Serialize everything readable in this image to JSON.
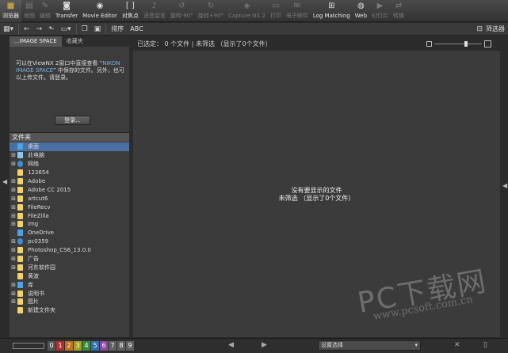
{
  "toolbar": {
    "buttons": [
      {
        "label": "浏览器",
        "icon": "browser-icon",
        "glyph": "▦",
        "active": true
      },
      {
        "label": "地图",
        "icon": "map-icon",
        "glyph": "▤",
        "dim": true
      },
      {
        "label": "编辑",
        "icon": "edit-icon",
        "glyph": "✎",
        "dim": true
      },
      {
        "label": "Transfer",
        "icon": "camera-icon",
        "glyph": "◙"
      },
      {
        "label": "Movie Editor",
        "icon": "movie-icon",
        "glyph": "◉"
      },
      {
        "label": "对焦点",
        "icon": "focus-icon",
        "glyph": "[ ]"
      },
      {
        "label": "语音留言",
        "icon": "voice-icon",
        "glyph": "♪",
        "dim": true
      },
      {
        "label": "旋转-90°",
        "icon": "rotate-left-icon",
        "glyph": "↺",
        "dim": true
      },
      {
        "label": "旋转+90°",
        "icon": "rotate-right-icon",
        "glyph": "↻",
        "dim": true
      },
      {
        "label": "Capture NX 2",
        "icon": "capture-icon",
        "glyph": "◈",
        "dim": true
      },
      {
        "label": "打印",
        "icon": "print-icon",
        "glyph": "▭",
        "dim": true
      },
      {
        "label": "电子邮件",
        "icon": "email-icon",
        "glyph": "✉",
        "dim": true
      },
      {
        "label": "Log Matching",
        "icon": "log-icon",
        "glyph": "⊞"
      },
      {
        "label": "Web",
        "icon": "web-icon",
        "glyph": "◍"
      },
      {
        "label": "幻灯片",
        "icon": "slideshow-icon",
        "glyph": "▶",
        "dim": true
      },
      {
        "label": "转换",
        "icon": "convert-icon",
        "glyph": "⇄",
        "dim": true
      }
    ]
  },
  "subbar": {
    "sort_label": "排序",
    "sort_value": "ABC",
    "filter_label": "筛选器"
  },
  "leftpane": {
    "tabs": [
      "...IMAGE SPACE",
      "收藏夹"
    ],
    "info_pre": "可以在ViewNX 2窗口中直接查看 “",
    "info_link": "NIKON IMAGE SPACE",
    "info_post": "” 中保存的文件。另外，也可以上传文件。请登录。",
    "login_button": "登录...",
    "folder_header": "文件夹",
    "tree": [
      {
        "label": "桌面",
        "exp": "",
        "icon": "f-blue",
        "sel": true
      },
      {
        "label": "此电脑",
        "exp": "+",
        "icon": "f-pc"
      },
      {
        "label": "网络",
        "exp": "+",
        "icon": "f-globe"
      },
      {
        "label": "123654",
        "exp": "",
        "icon": "f-yellow"
      },
      {
        "label": "Adobe",
        "exp": "+",
        "icon": "f-yellow"
      },
      {
        "label": "Adobe CC 2015",
        "exp": "+",
        "icon": "f-yellow"
      },
      {
        "label": "artcut6",
        "exp": "+",
        "icon": "f-yellow"
      },
      {
        "label": "FileRecv",
        "exp": "+",
        "icon": "f-yellow"
      },
      {
        "label": "FileZilla",
        "exp": "+",
        "icon": "f-yellow"
      },
      {
        "label": "img",
        "exp": "+",
        "icon": "f-yellow"
      },
      {
        "label": "OneDrive",
        "exp": "",
        "icon": "f-blue"
      },
      {
        "label": "pc0359",
        "exp": "+",
        "icon": "f-globe"
      },
      {
        "label": "Photoshop_CS6_13.0.0",
        "exp": "+",
        "icon": "f-yellow"
      },
      {
        "label": "广告",
        "exp": "+",
        "icon": "f-yellow"
      },
      {
        "label": "河东软件园",
        "exp": "+",
        "icon": "f-yellow"
      },
      {
        "label": "黄波",
        "exp": "",
        "icon": "f-yellow"
      },
      {
        "label": "库",
        "exp": "+",
        "icon": "f-blue"
      },
      {
        "label": "说明书",
        "exp": "+",
        "icon": "f-yellow"
      },
      {
        "label": "图片",
        "exp": "+",
        "icon": "f-yellow"
      },
      {
        "label": "新建文件夹",
        "exp": "",
        "icon": "f-yellow"
      }
    ]
  },
  "content": {
    "status": "已选定： 0 个文件 | 未筛选 （显示了0个文件）",
    "empty_line1": "没有要显示的文件",
    "empty_line2": "未筛选 （显示了0个文件）"
  },
  "bottombar": {
    "labels": [
      {
        "n": "0",
        "color": "#555555"
      },
      {
        "n": "1",
        "color": "#b03030"
      },
      {
        "n": "2",
        "color": "#c07020"
      },
      {
        "n": "3",
        "color": "#a0a020"
      },
      {
        "n": "4",
        "color": "#3a8a3a"
      },
      {
        "n": "5",
        "color": "#2f6fb0"
      },
      {
        "n": "6",
        "color": "#8a4aa0"
      },
      {
        "n": "7",
        "color": "#606060"
      },
      {
        "n": "8",
        "color": "#606060"
      },
      {
        "n": "9",
        "color": "#606060"
      }
    ],
    "select_value": "设置选择"
  },
  "watermark": {
    "big": "PC下载网",
    "small": "www.pcsoft.com.cn"
  }
}
